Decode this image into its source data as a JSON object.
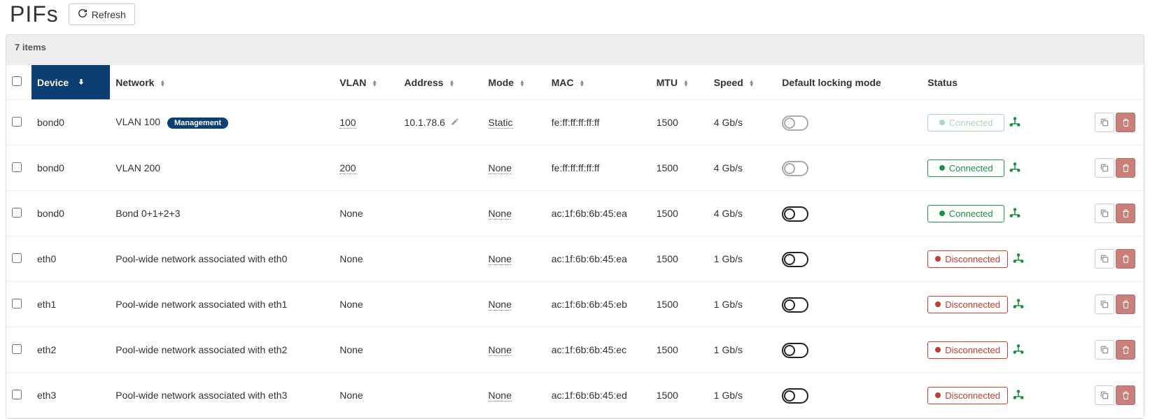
{
  "page": {
    "title": "PIFs",
    "refresh_label": "Refresh",
    "item_count_text": "7 items"
  },
  "columns": {
    "device": "Device",
    "network": "Network",
    "vlan": "VLAN",
    "address": "Address",
    "mode": "Mode",
    "mac": "MAC",
    "mtu": "MTU",
    "speed": "Speed",
    "locking": "Default locking mode",
    "status": "Status"
  },
  "badges": {
    "management": "Management"
  },
  "status_labels": {
    "connected": "Connected",
    "disconnected": "Disconnected"
  },
  "rows": [
    {
      "device": "bond0",
      "network": "VLAN 100",
      "management": true,
      "vlan": "100",
      "address": "10.1.78.6",
      "mode": "Static",
      "mac": "fe:ff:ff:ff:ff:ff",
      "mtu": "1500",
      "speed": "4 Gb/s",
      "lock_bold": false,
      "status": "connected",
      "faded": true
    },
    {
      "device": "bond0",
      "network": "VLAN 200",
      "management": false,
      "vlan": "200",
      "address": "",
      "mode": "None",
      "mac": "fe:ff:ff:ff:ff:ff",
      "mtu": "1500",
      "speed": "4 Gb/s",
      "lock_bold": false,
      "status": "connected",
      "faded": false
    },
    {
      "device": "bond0",
      "network": "Bond 0+1+2+3",
      "management": false,
      "vlan": "None",
      "address": "",
      "mode": "None",
      "mac": "ac:1f:6b:6b:45:ea",
      "mtu": "1500",
      "speed": "4 Gb/s",
      "lock_bold": true,
      "status": "connected",
      "faded": false
    },
    {
      "device": "eth0",
      "network": "Pool-wide network associated with eth0",
      "management": false,
      "vlan": "None",
      "address": "",
      "mode": "None",
      "mac": "ac:1f:6b:6b:45:ea",
      "mtu": "1500",
      "speed": "1 Gb/s",
      "lock_bold": true,
      "status": "disconnected",
      "faded": false
    },
    {
      "device": "eth1",
      "network": "Pool-wide network associated with eth1",
      "management": false,
      "vlan": "None",
      "address": "",
      "mode": "None",
      "mac": "ac:1f:6b:6b:45:eb",
      "mtu": "1500",
      "speed": "1 Gb/s",
      "lock_bold": true,
      "status": "disconnected",
      "faded": false
    },
    {
      "device": "eth2",
      "network": "Pool-wide network associated with eth2",
      "management": false,
      "vlan": "None",
      "address": "",
      "mode": "None",
      "mac": "ac:1f:6b:6b:45:ec",
      "mtu": "1500",
      "speed": "1 Gb/s",
      "lock_bold": true,
      "status": "disconnected",
      "faded": false
    },
    {
      "device": "eth3",
      "network": "Pool-wide network associated with eth3",
      "management": false,
      "vlan": "None",
      "address": "",
      "mode": "None",
      "mac": "ac:1f:6b:6b:45:ed",
      "mtu": "1500",
      "speed": "1 Gb/s",
      "lock_bold": true,
      "status": "disconnected",
      "faded": false
    }
  ]
}
